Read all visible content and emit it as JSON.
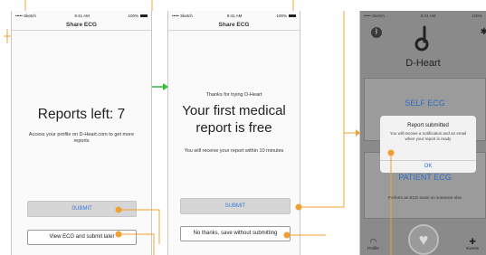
{
  "colors": {
    "connector": "#f0a030",
    "flow_arrow": "#33bb33",
    "link_blue": "#3a7bd5"
  },
  "screen1": {
    "status": {
      "carrier": "••••• Sketch",
      "time": "9:41 AM",
      "battery": "100%"
    },
    "title": "Share ECG",
    "reports_left": "Reports left: 7",
    "access_text": "Access your profile on D-Heart.com to get more reports",
    "submit_label": "SUBMIT",
    "secondary_label": "View ECG and submit later"
  },
  "screen2": {
    "status": {
      "carrier": "••••• Sketch",
      "time": "9:41 AM",
      "battery": "100%"
    },
    "title": "Share ECG",
    "thanks": "Thanks for trying D-Heart",
    "headline": "Your first medical report is free",
    "receive_text": "You will receive your report within 10 minutes",
    "submit_label": "SUBMIT",
    "secondary_label": "No thanks, save without submitting"
  },
  "screen3": {
    "status": {
      "carrier": "••••• Sketch",
      "time": "9:41 AM",
      "battery": "100%"
    },
    "brand": "D-Heart",
    "self_ecg": "SELF ECG",
    "patient_ecg": "PATIENT ECG",
    "patient_sub": "Perform an ECG exam on someone else",
    "dialog": {
      "title": "Report submitted",
      "message": "You will receive a notification and an email when your report is ready",
      "ok_label": "OK"
    },
    "tabs": {
      "profile": "Profile",
      "events": "Events"
    }
  }
}
